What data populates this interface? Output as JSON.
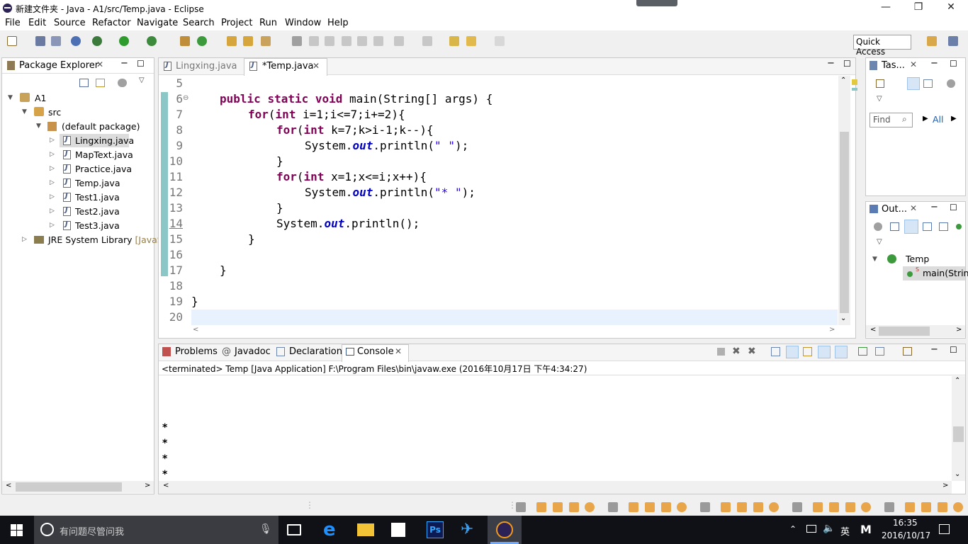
{
  "window": {
    "title": "新建文件夹 - Java - A1/src/Temp.java - Eclipse",
    "min": "—",
    "max": "❐",
    "close": "✕"
  },
  "menu": [
    "File",
    "Edit",
    "Source",
    "Refactor",
    "Navigate",
    "Search",
    "Project",
    "Run",
    "Window",
    "Help"
  ],
  "toolbar": {
    "quick_access": "Quick Access"
  },
  "package_explorer": {
    "title": "Package Explorer",
    "project": "A1",
    "src": "src",
    "pkg": "(default package)",
    "files": [
      "Lingxing.java",
      "MapText.java",
      "Practice.java",
      "Temp.java",
      "Test1.java",
      "Test2.java",
      "Test3.java"
    ],
    "jre": "JRE System Library",
    "jre_suffix": "[JavaS"
  },
  "editor": {
    "tabs": [
      {
        "label": "Lingxing.java",
        "active": false
      },
      {
        "label": "*Temp.java",
        "active": true
      }
    ],
    "line_numbers": [
      "5",
      "6",
      "7",
      "8",
      "9",
      "10",
      "11",
      "12",
      "13",
      "14",
      "15",
      "16",
      "17",
      "18",
      "19",
      "20"
    ]
  },
  "tasks": {
    "title": "Tas...",
    "find_placeholder": "Find",
    "all": "All"
  },
  "outline": {
    "title": "Out...",
    "class_name": "Temp",
    "method": "main(Strin"
  },
  "bottom_tabs": [
    "Problems",
    "Javadoc",
    "Declaration",
    "Console"
  ],
  "console": {
    "status": "<terminated> Temp [Java Application] F:\\Program Files\\bin\\javaw.exe (2016年10月17日 下午4:34:27)",
    "output": [
      "*",
      "*",
      "*",
      "*"
    ]
  },
  "taskbar": {
    "search_placeholder": "有问题尽管问我",
    "ime": "英",
    "time": "16:35",
    "date": "2016/10/17"
  },
  "colors": {
    "keyword": "#7f0055",
    "field": "#0000c0",
    "string": "#2a00ff",
    "taskbar": "#0f1117"
  }
}
